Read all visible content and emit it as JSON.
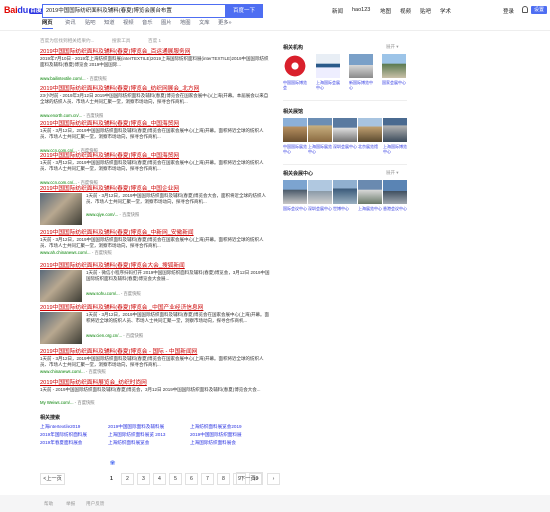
{
  "header": {
    "logo_bai": "Bai",
    "logo_paw": "du",
    "logo_cn": "百度",
    "query": "2019中国国际纺织面料及辅料(春夏)博览会展台布置",
    "search_button": "百度一下",
    "links": [
      "新闻",
      "hao123",
      "地图",
      "视频",
      "贴吧",
      "学术",
      "登录"
    ],
    "settings_label": "设置"
  },
  "tabs": [
    "网页",
    "资讯",
    "贴吧",
    "知道",
    "视频",
    "音乐",
    "图片",
    "地图",
    "文库",
    "更多»"
  ],
  "tools": {
    "count": "百度为您找到相关结果约...",
    "filter": "搜索工具",
    "tools": "百度 1"
  },
  "results": [
    {
      "title": "2019中国国际纺织面料及辅料(春夏)博览会_百运通展服务网",
      "desc": "2019年7月10日 - 2019年上海纺织面料展(interTEXTILE)2019上海国际纺织面料展(interTEXTILE)2019中国国际纺织面料及辅料(春夏)博览会 2019中国国际...",
      "url": "www.bailintextile.com/...",
      "snap": "- 百度快照"
    },
    {
      "title": "2019中国国际纺织面料及辅料(春夏)博览会_纺织网展会_北方网",
      "desc": "23小时前 - 2019年3月12日 2019中国国际纺织面料及辅料(春夏)博览会在国家会展中心(上海)开幕。本届展会以来自全球的纺织人员、市场人士共同汇聚一堂，洞察市场动向，探寻合作商机...",
      "url": "www.enorth.com.cn/...",
      "snap": "- 百度快照"
    },
    {
      "title": "2019中国国际纺织面料及辅料(春夏)博览会_中国海贸网",
      "desc": "1天前 - 3月12日，2019中国国际纺织面料及辅料(春夏)博览会在国家会展中心(上海)开幕。面积将近全球的纺织人员、市场人士共同汇聚一堂，洞察市场动向，探寻合作商机...",
      "url": "www.ccn.com.cn/...",
      "snap": "- 百度快照"
    },
    {
      "title": "2019中国国际纺织面料及辅料(春夏)博览会_中国海贸网",
      "desc": "1天前 - 3月12日，2019中国国际纺织面料及辅料(春夏)博览会在国家会展中心(上海)开幕。面积将近全球的纺织人员、市场人士共同汇聚一堂，洞察市场动向，探寻合作商机...",
      "url": "www.ccn.com.cn/...",
      "snap": "- 百度快照"
    },
    {
      "title": "2019中国国际纺织面料及辅料(春夏)博览会_中国企业网",
      "desc": "1天前 - 3月12日，2019中国国际纺织面料及辅料(春夏)博览会大会，面积将近全球的纺织人员、市场人士共同汇聚一堂，洞察市场动向，探寻合作商机...",
      "url": "www.qiye.com/...",
      "snap": "- 百度快照"
    },
    {
      "title": "2019中国国际纺织面料及辅料(春夏)博览会_中新网_安徽新闻",
      "desc": "1天前 - 3月12日，2019中国国际纺织面料及辅料(春夏)博览会在国家会展中心(上海)开幕。面积将近全球的纺织人员、市场人士共同汇聚一堂，洞察市场动向，探寻合作商机...",
      "url": "www.ah.chinanews.com/...",
      "snap": "- 百度快照"
    },
    {
      "title": "2019中国国际纺织面料及辅料(春夏)博览会大会_搜狐新闻",
      "desc": "1天前 - 微信小程序扫码打开 2019中国国际纺织面料及辅料(春夏)博览会，3月12日 2019中国国际纺织面料及辅料(春夏)博览会大会展...",
      "url": "www.sohu.com/...",
      "snap": "- 百度快照"
    },
    {
      "title": "2019中国国际纺织面料及辅料(春夏)博览会 _中国产业经济信息网",
      "desc": "1天前 - 3月12日，2019中国国际纺织面料及辅料(春夏)博览会在国家会展中心(上海)开幕。面积将近全球的纺织人员、市场人士共同汇聚一堂，洞察市场动向，探寻合作商机...",
      "url": "www.cien.org.cn/...",
      "snap": "- 百度快照"
    },
    {
      "title": "2019中国国际纺织面料及辅料(春夏)博览会 - 国际 - 中国新闻网",
      "desc": "1天前 - 3月12日，2019中国国际纺织面料及辅料(春夏)博览会在国家会展中心(上海)开幕。面积将近全球的纺织人员、市场人士共同汇聚一堂，洞察市场动向，探寻合作商机...",
      "url": "www.chinanews.com/...",
      "snap": "- 百度快照"
    },
    {
      "title": "2019中国国际纺织面料展览会_纺织时尚网",
      "desc": "1天前 - 2019中国国际纺织面料及辅料(春夏)博览会，3月12日 2019中国国际纺织面料及辅料(春夏)博览会大会...",
      "url": "My Weiws.com/...",
      "snap": "- 百度快照"
    }
  ],
  "related": {
    "title": "相关搜索",
    "items": [
      "上海intertextile2019",
      "2019中国国际面料及辅料展",
      "上海纺织面料展览会2019",
      "2019年国际纺织面料展",
      "上海国际纺织面料展览 2013",
      "2019中国国际纺织面料展",
      "2019年春夏面料展会",
      "上海纺织面料展览会",
      "上海国际纺织面料展会"
    ]
  },
  "pager": {
    "prev": "<上一页",
    "pages": [
      "1",
      "2",
      "3",
      "4",
      "5",
      "6",
      "7",
      "8",
      "9",
      "10"
    ],
    "next": "下一页>",
    "current": "1"
  },
  "footer": [
    "帮助",
    "举报",
    "用户反馈"
  ],
  "sidebar": {
    "sections": [
      {
        "title": "相关机构",
        "expand": "展开 ▾",
        "items": [
          "中国国际博览会",
          "上海国际会展中心",
          "新国际博览中心",
          "国家会展中心"
        ]
      },
      {
        "title": "相关展馆",
        "expand": "",
        "items": [
          "中国国际展览中心",
          "上海国际展览中心",
          "深圳会展中心",
          "北京展览馆",
          "上海国际博览中心"
        ]
      },
      {
        "title": "相关会展中心",
        "expand": "展开 ▾",
        "items": [
          "国际会议中心",
          "深圳会展中心",
          "世博中心",
          "上海展览中心",
          "香港会议中心"
        ]
      }
    ]
  },
  "colors": {
    "accent": "#4e6ef2",
    "title_red": "#c00",
    "url_green": "#008000",
    "link_blue": "#2932e1"
  }
}
